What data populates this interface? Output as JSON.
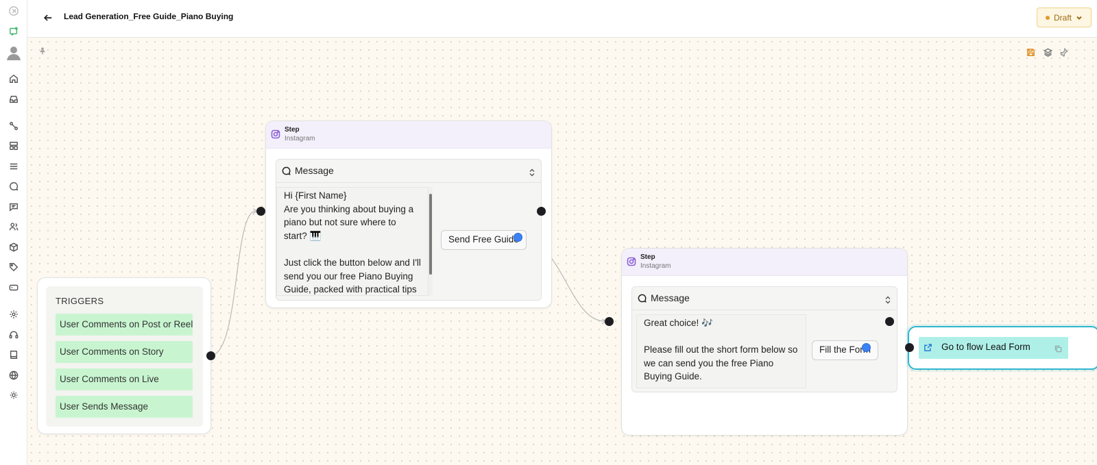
{
  "header": {
    "title": "Lead Generation_Free Guide_Piano Buying",
    "status_label": "Draft",
    "status_color": "#e19a2a"
  },
  "sidebar": {
    "icons": [
      "collapse-icon",
      "chat-bot-icon",
      "avatar",
      "home-icon",
      "inbox-icon",
      "flows-icon",
      "templates-icon",
      "list-icon",
      "chat-icon",
      "messages-icon",
      "contacts-icon",
      "products-icon",
      "tags-icon",
      "billing-icon",
      "settings-icon",
      "support-icon",
      "book-icon",
      "globe-icon",
      "theme-icon"
    ]
  },
  "canvas": {
    "toolbar_icons": [
      "save-icon",
      "layers-icon",
      "pin-icon"
    ],
    "edge_color": "#b9b9b9"
  },
  "triggers": {
    "title": "TRIGGERS",
    "items": [
      {
        "label": "User Comments on Post or Reel"
      },
      {
        "label": "User Comments on Story"
      },
      {
        "label": "User Comments on Live"
      },
      {
        "label": "User Sends Message"
      }
    ],
    "item_color": "#c8f5d0"
  },
  "steps": [
    {
      "title": "Step",
      "channel": "Instagram",
      "message_label": "Message",
      "message_text": "Hi {First Name}\nAre you thinking about buying a piano but not sure where to start? 🎹\n\nJust click the button below and I'll send you our free Piano Buying Guide, packed with practical tips to",
      "button_label": "Send Free Guide"
    },
    {
      "title": "Step",
      "channel": "Instagram",
      "message_label": "Message",
      "message_text": "Great choice! 🎶\n\nPlease fill out the short form below so we can send you the free Piano Buying Guide.",
      "button_label": "Fill the Form"
    }
  ],
  "goto": {
    "label": "Go to flow Lead Form",
    "color": "#aef0e8"
  },
  "accent": {
    "instagram": "#8a5fd6",
    "handle": "#3b82f6"
  }
}
